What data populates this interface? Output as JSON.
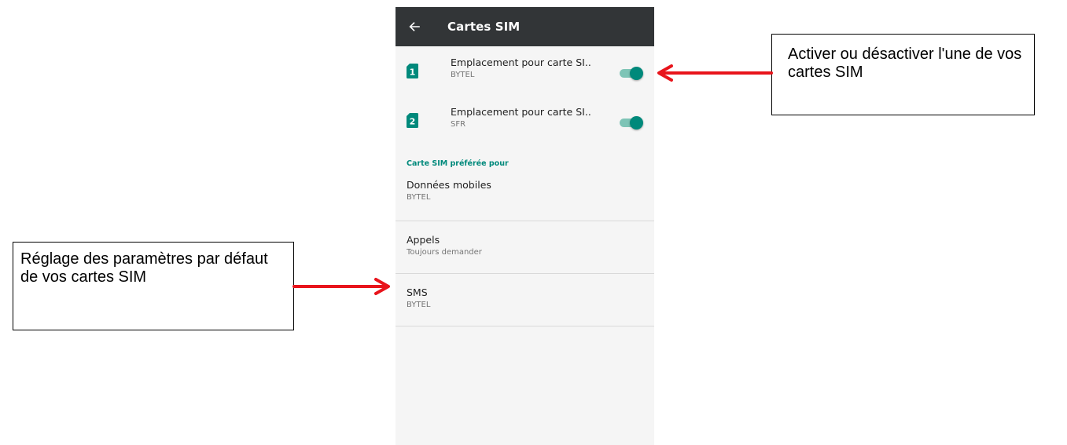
{
  "appbar": {
    "title": "Cartes SIM",
    "back_icon": "arrow-left-icon"
  },
  "sims": [
    {
      "slot": "1",
      "title": "Emplacement pour carte SI..",
      "operator": "BYTEL",
      "enabled": true
    },
    {
      "slot": "2",
      "title": "Emplacement pour carte SI..",
      "operator": "SFR",
      "enabled": true
    }
  ],
  "preferred": {
    "header": "Carte SIM préférée pour",
    "items": [
      {
        "title": "Données mobiles",
        "value": "BYTEL"
      },
      {
        "title": "Appels",
        "value": "Toujours demander"
      },
      {
        "title": "SMS",
        "value": "BYTEL"
      }
    ]
  },
  "annotations": {
    "toggle_note": "Activer ou désactiver l'une de vos cartes SIM",
    "defaults_note": "Réglage des paramètres par défaut de vos cartes SIM"
  },
  "colors": {
    "appbar": "#323537",
    "accent": "#00897b",
    "switch_track": "#7ec4b6",
    "arrow": "#e8141b",
    "screen_bg": "#f5f5f5"
  }
}
